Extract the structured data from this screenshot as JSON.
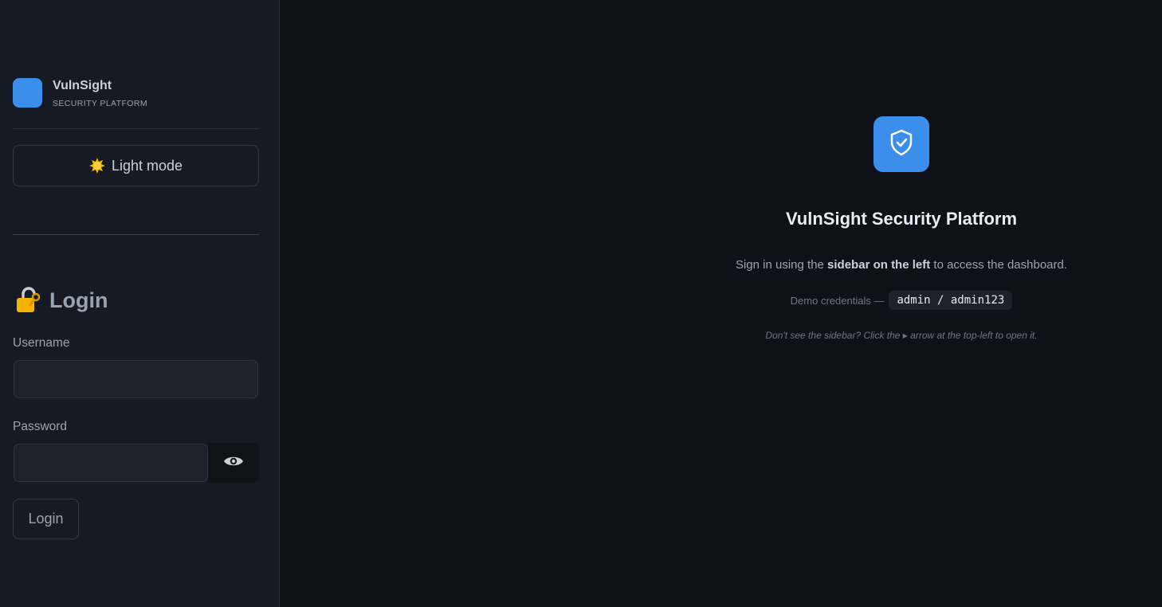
{
  "brand": {
    "name": "VulnSight",
    "subtitle": "SECURITY PLATFORM",
    "logo_color": "#3b8eea"
  },
  "theme_toggle": {
    "icon": "sun-icon",
    "label": "Light mode"
  },
  "login": {
    "icon": "lock-icon",
    "title": "Login",
    "username_label": "Username",
    "username_value": "",
    "password_label": "Password",
    "password_value": "",
    "reveal_icon": "eye-icon",
    "submit_label": "Login"
  },
  "main": {
    "icon": "shield-check-icon",
    "title": "VulnSight Security Platform",
    "sign_in_prefix": "Sign in using the ",
    "sign_in_bold": "sidebar on the left",
    "sign_in_suffix": " to access the dashboard.",
    "creds_label": "Demo credentials —",
    "creds_value": "admin / admin123",
    "hint": "Don't see the sidebar? Click the ▸ arrow at the top-left to open it."
  },
  "colors": {
    "accent": "#3b8eea",
    "background": "#0e1117",
    "sidebar": "#161a22"
  }
}
